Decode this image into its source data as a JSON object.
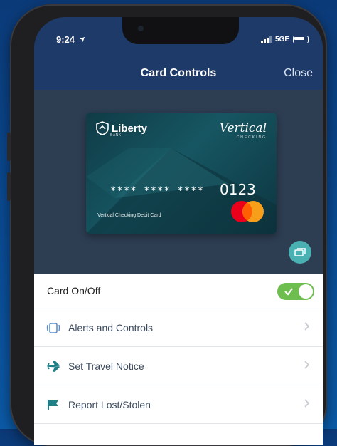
{
  "status_bar": {
    "time": "9:24",
    "network": "5GE"
  },
  "header": {
    "title": "Card Controls",
    "close_label": "Close"
  },
  "card": {
    "bank_name": "Liberty",
    "bank_sub": "BANK",
    "product": "Vertical",
    "product_sub": "CHECKING",
    "masked_number": "**** **** ****",
    "last_four": "0123",
    "card_name": "Vertical Checking Debit Card"
  },
  "controls": {
    "toggle_label": "Card On/Off",
    "toggle_on": true,
    "items": [
      {
        "label": "Alerts and Controls",
        "icon": "alerts-icon"
      },
      {
        "label": "Set Travel Notice",
        "icon": "airplane-icon"
      },
      {
        "label": "Report Lost/Stolen",
        "icon": "flag-icon"
      }
    ]
  },
  "colors": {
    "header_bg": "#1d3a68",
    "accent": "#49b1b2",
    "toggle_on": "#6ebd4f",
    "icon_blue": "#5a8fcf",
    "icon_teal": "#1f7f86"
  }
}
